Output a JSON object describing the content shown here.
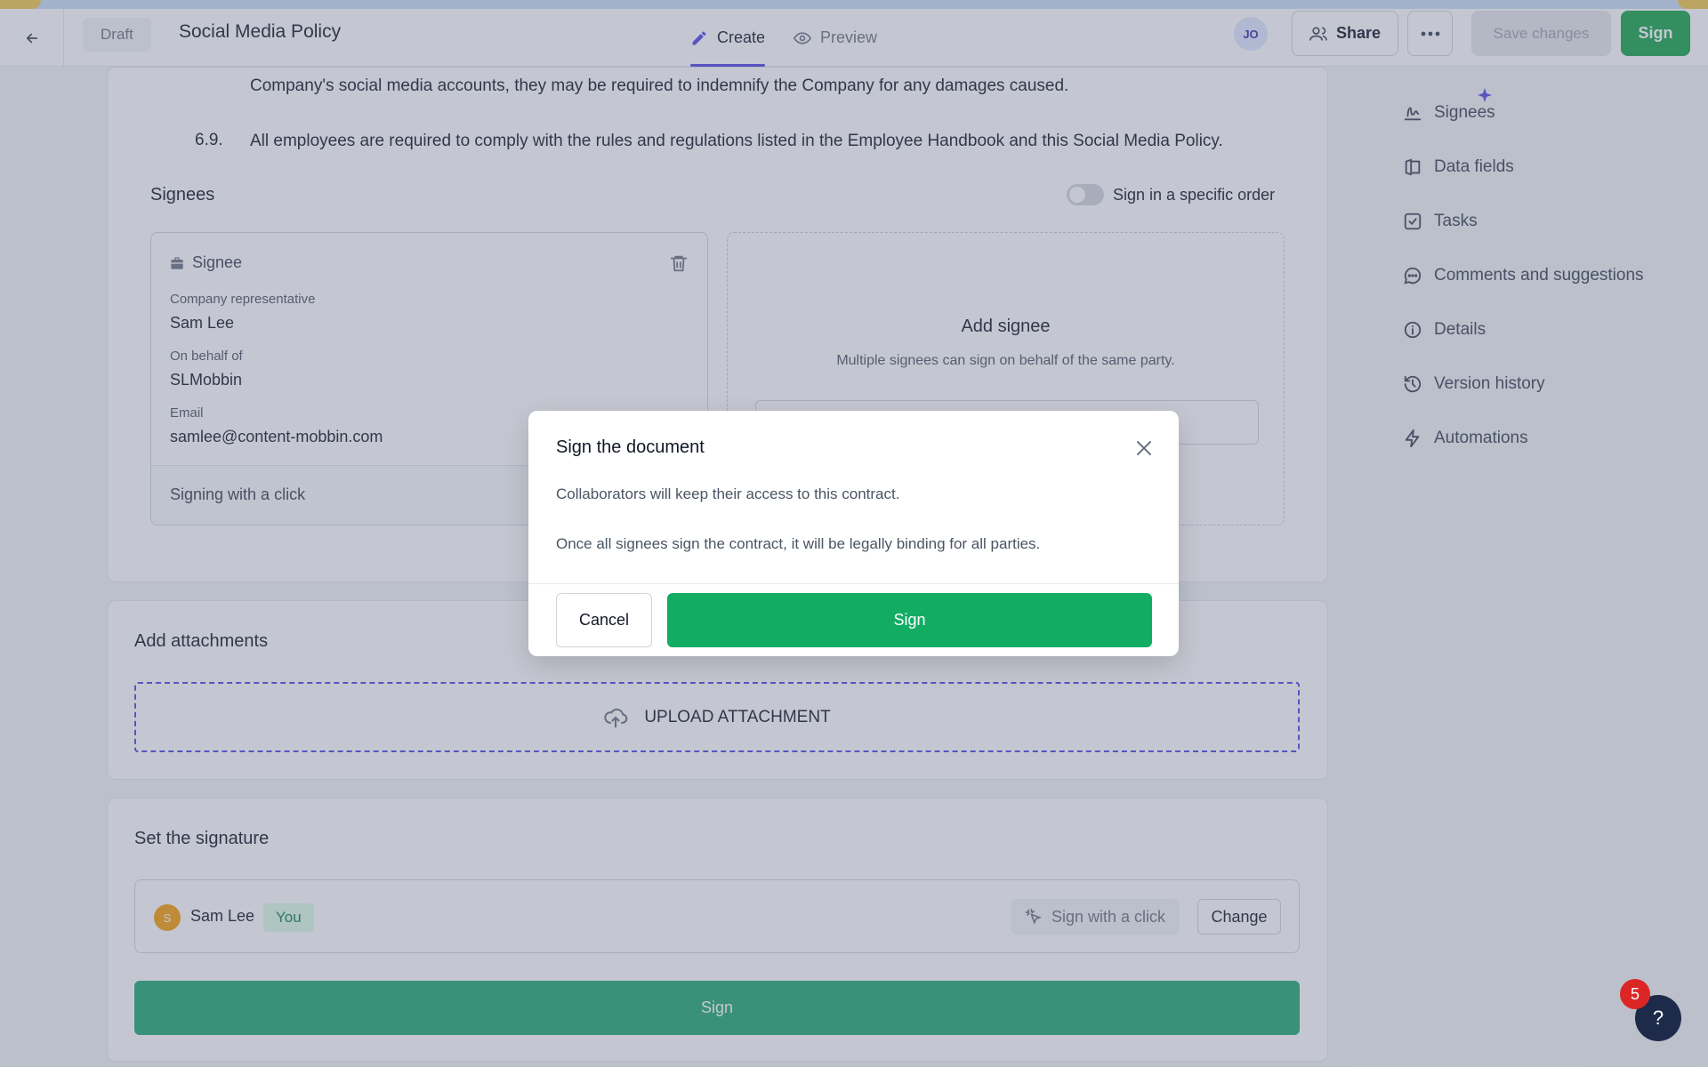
{
  "topbar": {
    "draft_label": "Draft",
    "doc_title": "Social Media Policy",
    "tabs": [
      {
        "label": "Create",
        "active": true
      },
      {
        "label": "Preview",
        "active": false
      }
    ],
    "avatar_initials": "JO",
    "share_label": "Share",
    "save_label": "Save changes",
    "sign_label": "Sign"
  },
  "document": {
    "para_fragment": "Company's social media accounts, they may be required to indemnify the Company for any damages caused.",
    "para_6_9_num": "6.9.",
    "para_6_9_text": "All employees are required to comply with the rules and regulations listed in the Employee Handbook and this Social Media Policy."
  },
  "signees": {
    "title": "Signees",
    "order_toggle_label": "Sign in a specific order",
    "card": {
      "header": "Signee",
      "role_label": "Company representative",
      "role_value": "Sam Lee",
      "behalf_label": "On behalf of",
      "behalf_value": "SLMobbin",
      "email_label": "Email",
      "email_value": "samlee@content-mobbin.com",
      "footer_text": "Signing with a click"
    },
    "add": {
      "title": "Add signee",
      "subtitle": "Multiple signees can sign on behalf of the same party."
    }
  },
  "attachments": {
    "title": "Add attachments",
    "upload_label": "UPLOAD ATTACHMENT"
  },
  "signature": {
    "title": "Set the signature",
    "avatar_initial": "S",
    "name": "Sam Lee",
    "you_badge": "You",
    "sign_with_click": "Sign with a click",
    "change_label": "Change",
    "sign_button": "Sign"
  },
  "sidebar": {
    "items": [
      {
        "label": "Signees",
        "icon": "signature-icon"
      },
      {
        "label": "Data fields",
        "icon": "data-fields-icon"
      },
      {
        "label": "Tasks",
        "icon": "checkbox-icon"
      },
      {
        "label": "Comments and suggestions",
        "icon": "comment-icon"
      },
      {
        "label": "Details",
        "icon": "info-icon"
      },
      {
        "label": "Version history",
        "icon": "history-icon"
      },
      {
        "label": "Automations",
        "icon": "lightning-icon"
      }
    ]
  },
  "modal": {
    "title": "Sign the document",
    "line1": "Collaborators will keep their access to this contract.",
    "line2": "Once all signees sign the contract, it will be legally binding for all parties.",
    "cancel_label": "Cancel",
    "sign_label": "Sign"
  },
  "help": {
    "notification_count": "5",
    "help_label": "?"
  },
  "colors": {
    "primary_green": "#16a34a",
    "accent_indigo": "#4f46e5"
  }
}
